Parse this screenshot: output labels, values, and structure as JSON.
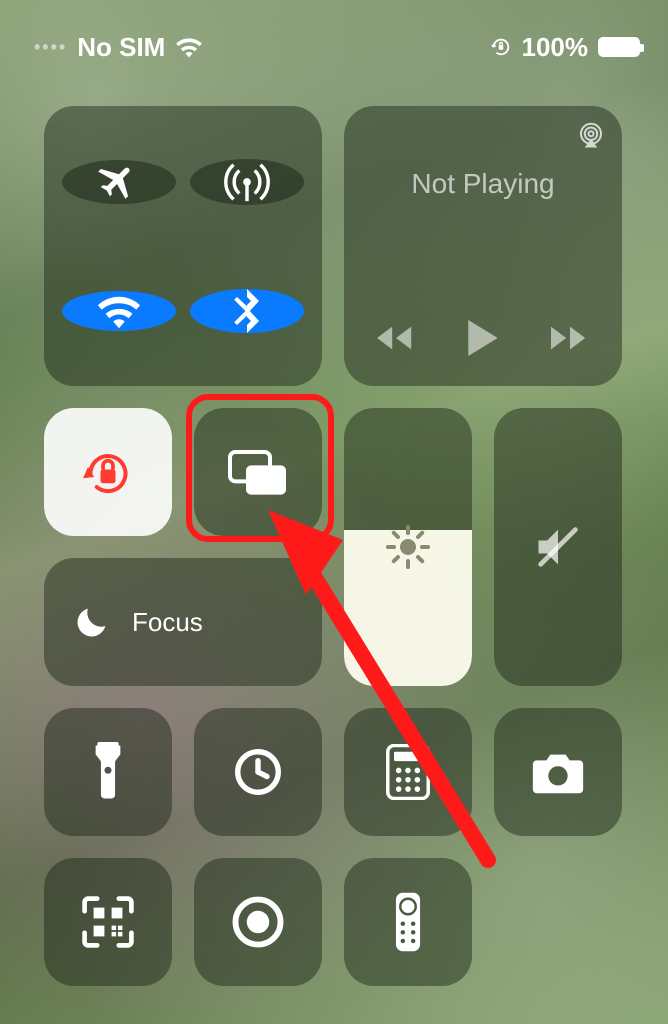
{
  "status": {
    "carrier": "No SIM",
    "battery_pct": "100%"
  },
  "media": {
    "now_playing": "Not Playing"
  },
  "focus": {
    "label": "Focus"
  },
  "brightness": {
    "level_pct": 56
  },
  "colors": {
    "active_blue": "#0a7aff",
    "annotation_red": "#ff1a1a",
    "orientation_red": "#ff3b30"
  },
  "annotation": {
    "highlight_target": "screen-mirroring-toggle",
    "arrow": true
  }
}
